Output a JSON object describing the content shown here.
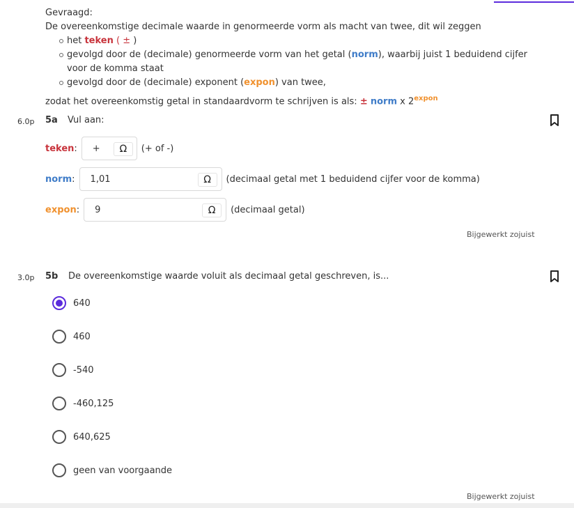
{
  "intro": {
    "heading": "Gevraagd:",
    "line1": "De overeenkomstige decimale waarde in genormeerde vorm als macht van twee, dit wil zeggen",
    "bullet1_pre": "het ",
    "bullet1_term": "teken",
    "bullet1_open": " ( ",
    "bullet1_sym": "±",
    "bullet1_close": " )",
    "bullet2_pre": "gevolgd door de (decimale) genormeerde vorm van het getal (",
    "bullet2_term": "norm",
    "bullet2_post": "), waarbij juist 1 beduidend cijfer voor de komma staat",
    "bullet3_pre": "gevolgd door de (decimale) exponent (",
    "bullet3_term": "expon",
    "bullet3_post": ") van twee,",
    "formula_pre": "zodat het overeenkomstig getal in standaardvorm te schrijven is als: ",
    "formula_sign": "±",
    "formula_norm": "norm",
    "formula_mid": " x 2",
    "formula_exp": "expon"
  },
  "q5a": {
    "points": "6.0p",
    "number": "5a",
    "text": "Vul aan:",
    "teken_label": "teken",
    "teken_value": "+",
    "teken_hint": "(+ of -)",
    "norm_label": "norm",
    "norm_value": "1,01",
    "norm_hint": "(decimaal getal met 1 beduidend cijfer voor de komma)",
    "expon_label": "expon",
    "expon_value": "9",
    "expon_hint": "(decimaal getal)",
    "omega": "Ω",
    "colon": ":",
    "updated": "Bijgewerkt zojuist"
  },
  "q5b": {
    "points": "3.0p",
    "number": "5b",
    "text": "De overeenkomstige waarde voluit als decimaal getal geschreven, is...",
    "options": [
      "640",
      "460",
      "-540",
      "-460,125",
      "640,625",
      "geen van voorgaande"
    ],
    "selected_index": 0,
    "updated": "Bijgewerkt zojuist"
  },
  "colors": {
    "accent": "#5b2bdc",
    "teken": "#c8343c",
    "norm": "#3f7cc8",
    "expon": "#f0912e"
  }
}
